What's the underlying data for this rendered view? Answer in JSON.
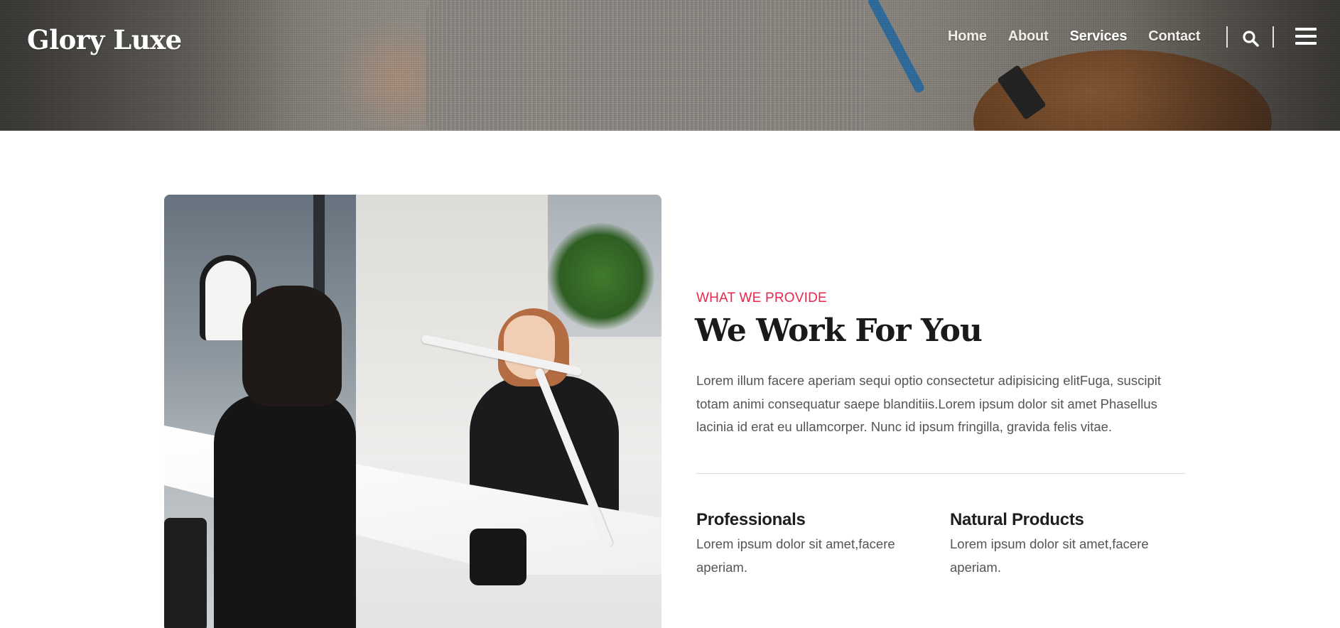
{
  "header": {
    "logo": "Glory Luxe",
    "nav": [
      {
        "label": "Home"
      },
      {
        "label": "About"
      },
      {
        "label": "Services",
        "active": true
      },
      {
        "label": "Contact"
      }
    ],
    "icons": {
      "search": "search-icon",
      "menu": "hamburger-menu-icon"
    }
  },
  "about": {
    "eyebrow": "WHAT WE PROVIDE",
    "title": "We Work For You",
    "body": "Lorem illum facere aperiam sequi optio consectetur adipisicing elitFuga, suscipit totam animi consequatur saepe blanditiis.Lorem ipsum dolor sit amet Phasellus lacinia id erat eu ullamcorper. Nunc id ipsum fringilla, gravida felis vitae.",
    "features": [
      {
        "title": "Professionals",
        "text": "Lorem ipsum dolor sit amet,facere aperiam."
      },
      {
        "title": "Natural Products",
        "text": "Lorem ipsum dolor sit amet,facere aperiam."
      }
    ]
  },
  "colors": {
    "accent": "#e8284c",
    "heading": "#1a1a1a",
    "body_text": "#555555",
    "divider": "#dedede"
  }
}
